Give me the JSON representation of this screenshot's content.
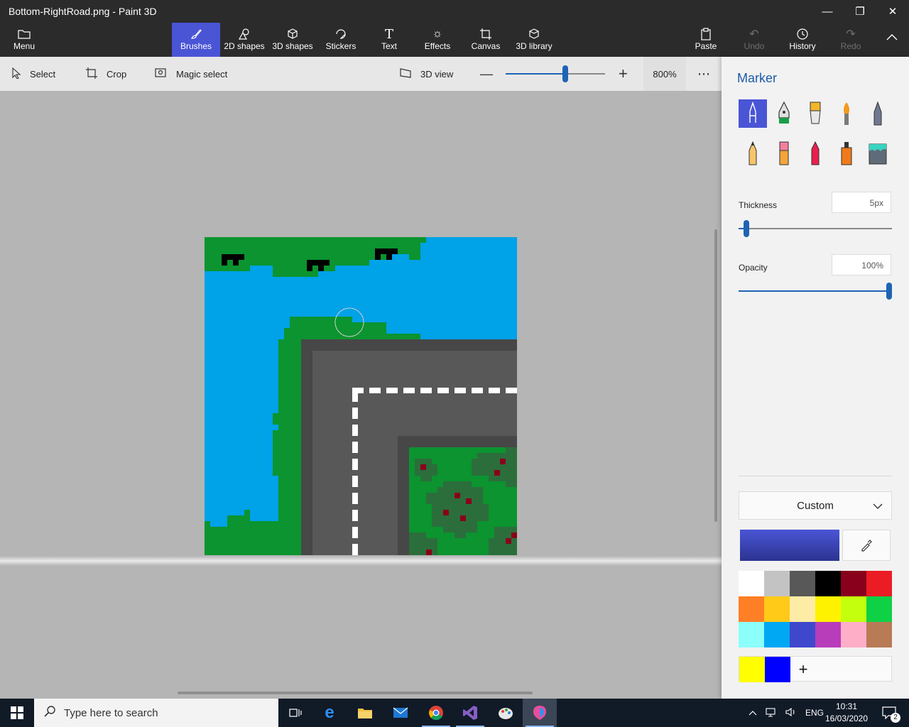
{
  "window": {
    "title": "Bottom-RightRoad.png - Paint 3D",
    "minimize_glyph": "—",
    "restore_glyph": "❐",
    "close_glyph": "✕"
  },
  "ribbon": {
    "menu": "Menu",
    "tabs": [
      "Brushes",
      "2D shapes",
      "3D shapes",
      "Stickers",
      "Text",
      "Effects",
      "Canvas",
      "3D library"
    ],
    "paste": "Paste",
    "undo": "Undo",
    "history": "History",
    "redo": "Redo"
  },
  "toolbar": {
    "select": "Select",
    "crop": "Crop",
    "magic_select": "Magic select",
    "view_3d": "3D view",
    "zoom": "800%",
    "zoom_level": 0.6,
    "more": "⋯"
  },
  "panel": {
    "title": "Marker",
    "brushes": [
      "marker",
      "calligraphy-pen",
      "oil-brush",
      "watercolor",
      "pixel-pen",
      "pencil",
      "eraser",
      "crayon",
      "spray-can",
      "fill"
    ],
    "thickness_label": "Thickness",
    "thickness_value": "5px",
    "thickness_level": 0.05,
    "opacity_label": "Opacity",
    "opacity_value": "100%",
    "opacity_level": 1.0,
    "color_mode": "Custom",
    "current_color": "#4a55d6",
    "palette": [
      "#ffffff",
      "#c3c3c3",
      "#585858",
      "#000000",
      "#88001b",
      "#ec1c24",
      "#ff7f27",
      "#ffca18",
      "#fdeca6",
      "#fff200",
      "#c4ff0e",
      "#0ed145",
      "#8cfffb",
      "#00a8f3",
      "#3f48cc",
      "#b83dba",
      "#ffaec8",
      "#b97a56"
    ],
    "custom_colors": [
      "#ffff00",
      "#0000ff"
    ],
    "add_color": "+"
  },
  "taskbar": {
    "search_placeholder": "Type here to search",
    "language": "ENG",
    "time": "10:31",
    "date": "16/03/2020",
    "notifications": "2"
  }
}
